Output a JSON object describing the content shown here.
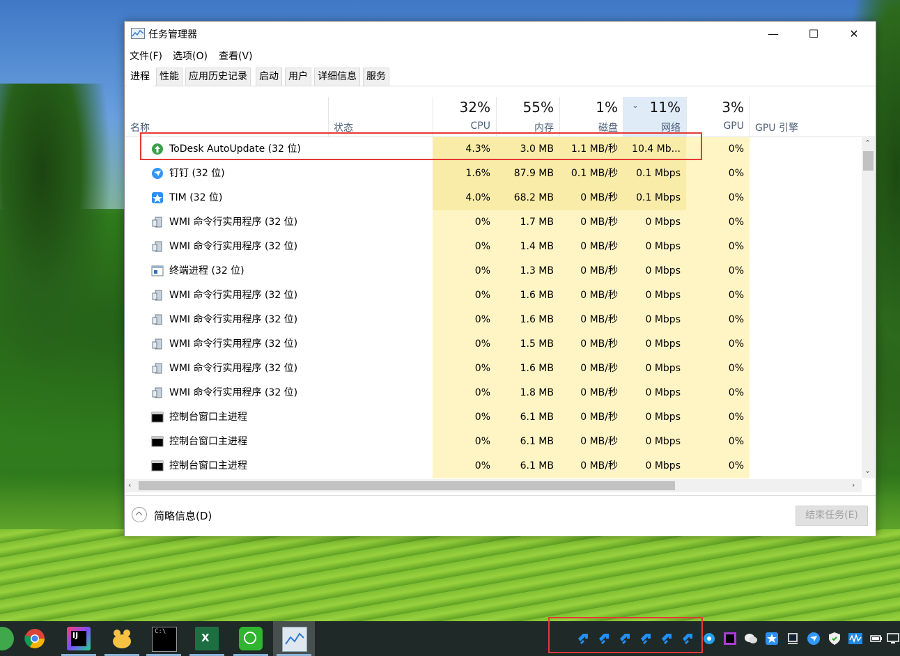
{
  "window": {
    "title": "任务管理器",
    "controls": {
      "minimize": "—",
      "maximize": "☐",
      "close": "✕"
    }
  },
  "menu": [
    "文件(F)",
    "选项(O)",
    "查看(V)"
  ],
  "tabs": [
    "进程",
    "性能",
    "应用历史记录",
    "启动",
    "用户",
    "详细信息",
    "服务"
  ],
  "active_tab": "进程",
  "columns": {
    "name": "名称",
    "status": "状态",
    "cpu": {
      "pct": "32%",
      "label": "CPU"
    },
    "memory": {
      "pct": "55%",
      "label": "内存"
    },
    "disk": {
      "pct": "1%",
      "label": "磁盘"
    },
    "network": {
      "pct": "11%",
      "label": "网络"
    },
    "gpu": {
      "pct": "3%",
      "label": "GPU"
    },
    "gpu_engine": "GPU 引擎"
  },
  "rows": [
    {
      "icon": "todesk-icon",
      "name": "ToDesk AutoUpdate (32 位)",
      "cpu": "4.3%",
      "mem": "3.0 MB",
      "disk": "1.1 MB/秒",
      "net": "10.4 Mb...",
      "gpu": "0%"
    },
    {
      "icon": "dingtalk-icon",
      "name": "钉钉 (32 位)",
      "cpu": "1.6%",
      "mem": "87.9 MB",
      "disk": "0.1 MB/秒",
      "net": "0.1 Mbps",
      "gpu": "0%"
    },
    {
      "icon": "tim-icon",
      "name": "TIM (32 位)",
      "cpu": "4.0%",
      "mem": "68.2 MB",
      "disk": "0 MB/秒",
      "net": "0.1 Mbps",
      "gpu": "0%"
    },
    {
      "icon": "wmi-icon",
      "name": "WMI 命令行实用程序 (32 位)",
      "cpu": "0%",
      "mem": "1.7 MB",
      "disk": "0 MB/秒",
      "net": "0 Mbps",
      "gpu": "0%"
    },
    {
      "icon": "wmi-icon",
      "name": "WMI 命令行实用程序 (32 位)",
      "cpu": "0%",
      "mem": "1.4 MB",
      "disk": "0 MB/秒",
      "net": "0 Mbps",
      "gpu": "0%"
    },
    {
      "icon": "terminal-process-icon",
      "name": "终端进程 (32 位)",
      "cpu": "0%",
      "mem": "1.3 MB",
      "disk": "0 MB/秒",
      "net": "0 Mbps",
      "gpu": "0%"
    },
    {
      "icon": "wmi-icon",
      "name": "WMI 命令行实用程序 (32 位)",
      "cpu": "0%",
      "mem": "1.6 MB",
      "disk": "0 MB/秒",
      "net": "0 Mbps",
      "gpu": "0%"
    },
    {
      "icon": "wmi-icon",
      "name": "WMI 命令行实用程序 (32 位)",
      "cpu": "0%",
      "mem": "1.6 MB",
      "disk": "0 MB/秒",
      "net": "0 Mbps",
      "gpu": "0%"
    },
    {
      "icon": "wmi-icon",
      "name": "WMI 命令行实用程序 (32 位)",
      "cpu": "0%",
      "mem": "1.5 MB",
      "disk": "0 MB/秒",
      "net": "0 Mbps",
      "gpu": "0%"
    },
    {
      "icon": "wmi-icon",
      "name": "WMI 命令行实用程序 (32 位)",
      "cpu": "0%",
      "mem": "1.6 MB",
      "disk": "0 MB/秒",
      "net": "0 Mbps",
      "gpu": "0%"
    },
    {
      "icon": "wmi-icon",
      "name": "WMI 命令行实用程序 (32 位)",
      "cpu": "0%",
      "mem": "1.8 MB",
      "disk": "0 MB/秒",
      "net": "0 Mbps",
      "gpu": "0%"
    },
    {
      "icon": "console-icon",
      "name": "控制台窗口主进程",
      "cpu": "0%",
      "mem": "6.1 MB",
      "disk": "0 MB/秒",
      "net": "0 Mbps",
      "gpu": "0%"
    },
    {
      "icon": "console-icon",
      "name": "控制台窗口主进程",
      "cpu": "0%",
      "mem": "6.1 MB",
      "disk": "0 MB/秒",
      "net": "0 Mbps",
      "gpu": "0%"
    },
    {
      "icon": "console-icon",
      "name": "控制台窗口主进程",
      "cpu": "0%",
      "mem": "6.1 MB",
      "disk": "0 MB/秒",
      "net": "0 Mbps",
      "gpu": "0%"
    }
  ],
  "footer": {
    "brief": "简略信息(D)",
    "end_task": "结束任务(E)"
  },
  "colors": {
    "heat_light": "#fff4c4",
    "heat_mid": "#f9eca8",
    "sorted_header": "#dfecf8",
    "highlight": "#e53935",
    "taskbar": "#1f2a28"
  },
  "taskbar": {
    "apps": [
      "green-app-icon",
      "chrome-icon",
      "intellij-icon",
      "baidu-netdisk-icon",
      "terminal-icon",
      "excel-icon",
      "screen-recorder-icon",
      "task-manager-icon"
    ],
    "tray": [
      "todesk-tray-icon",
      "todesk-tray-icon",
      "todesk-tray-icon",
      "todesk-tray-icon",
      "todesk-tray-icon",
      "todesk-tray-icon",
      "chat-bubble-icon",
      "intellij-tray-icon",
      "wechat-icon",
      "tim-tray-icon",
      "monitor-icon",
      "dingtalk-tray-icon",
      "security-shield-icon",
      "audio-wave-icon",
      "battery-icon",
      "network-monitor-icon"
    ]
  }
}
